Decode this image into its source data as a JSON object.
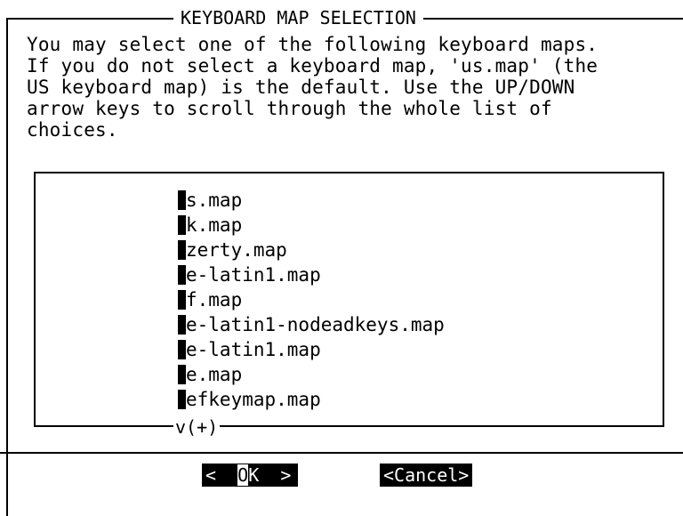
{
  "dialog": {
    "title": "KEYBOARD MAP SELECTION",
    "description": "You may select one of the following keyboard maps.\nIf you do not select a keyboard map, 'us.map' (the\nUS keyboard map) is the default. Use the UP/DOWN\narrow keys to scroll through the whole list of\nchoices."
  },
  "list": {
    "items": [
      {
        "first": "u",
        "rest": "s.map"
      },
      {
        "first": "u",
        "rest": "k.map"
      },
      {
        "first": "a",
        "rest": "zerty.map"
      },
      {
        "first": "b",
        "rest": "e-latin1.map"
      },
      {
        "first": "c",
        "rest": "f.map"
      },
      {
        "first": "d",
        "rest": "e-latin1-nodeadkeys.map"
      },
      {
        "first": "d",
        "rest": "e-latin1.map"
      },
      {
        "first": "d",
        "rest": "e.map"
      },
      {
        "first": "d",
        "rest": "efkeymap.map"
      }
    ],
    "more_indicator": "v(+)"
  },
  "buttons": {
    "ok": {
      "left": "<",
      "key": "O",
      "rest": "K",
      "right": ">"
    },
    "cancel": "<Cancel>"
  },
  "colors": {
    "foreground": "#000000",
    "background": "#ffffff"
  }
}
